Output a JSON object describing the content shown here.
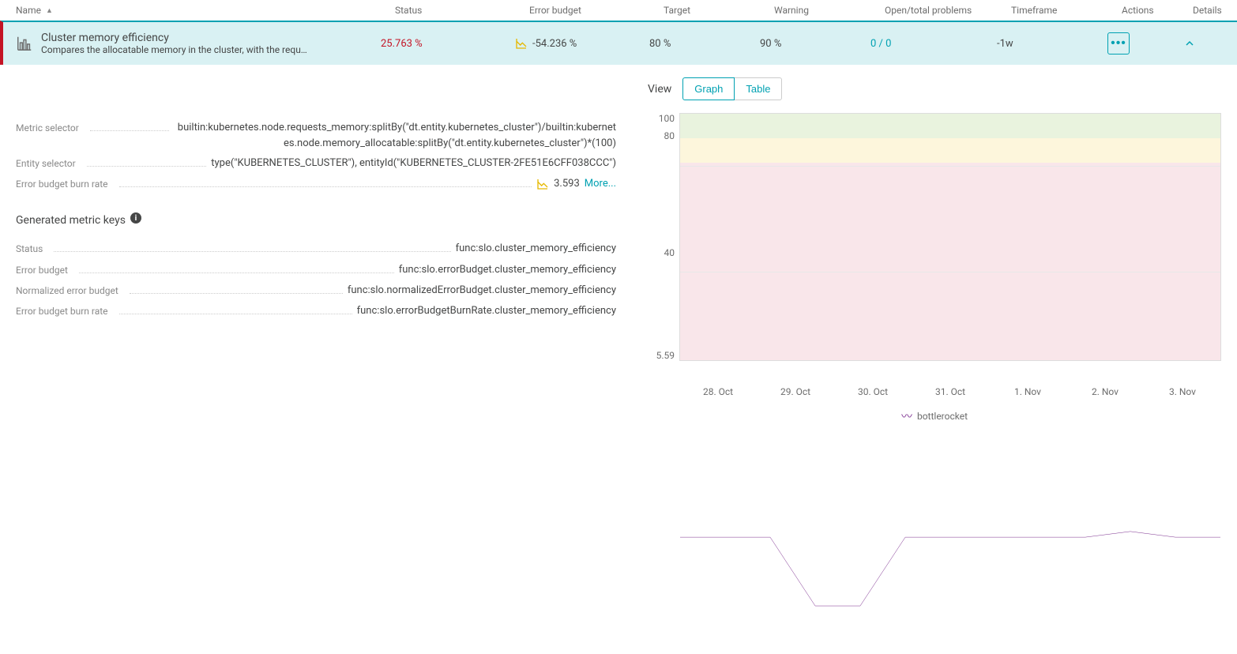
{
  "columns": {
    "name": "Name",
    "status": "Status",
    "error_budget": "Error budget",
    "target": "Target",
    "warning": "Warning",
    "problems": "Open/total problems",
    "timeframe": "Timeframe",
    "actions": "Actions",
    "details": "Details"
  },
  "row": {
    "title": "Cluster memory efficiency",
    "desc": "Compares the allocatable memory in the cluster, with the requ…",
    "status": "25.763 %",
    "error_budget": "-54.236 %",
    "target": "80 %",
    "warning": "90 %",
    "problems": "0 / 0",
    "timeframe": "-1w"
  },
  "details": {
    "labels": {
      "metric_selector": "Metric selector",
      "entity_selector": "Entity selector",
      "burn_rate": "Error budget burn rate",
      "status": "Status",
      "error_budget": "Error budget",
      "normalized": "Normalized error budget",
      "burn_rate2": "Error budget burn rate"
    },
    "metric_selector": "builtin:kubernetes.node.requests_memory:splitBy(\"dt.entity.kubernetes_cluster\")/builtin:kubernetes.node.memory_allocatable:splitBy(\"dt.entity.kubernetes_cluster\")*(100)",
    "entity_selector": "type(\"KUBERNETES_CLUSTER\"), entityId(\"KUBERNETES_CLUSTER-2FE51E6CFF038CCC\")",
    "burn_rate": "3.593",
    "more": "More...",
    "section_title": "Generated metric keys",
    "status_key": "func:slo.cluster_memory_efficiency",
    "error_budget_key": "func:slo.errorBudget.cluster_memory_efficiency",
    "normalized_key": "func:slo.normalizedErrorBudget.cluster_memory_efficiency",
    "burn_rate_key": "func:slo.errorBudgetBurnRate.cluster_memory_efficiency"
  },
  "view": {
    "label": "View",
    "graph": "Graph",
    "table": "Table"
  },
  "chart_data": {
    "type": "line",
    "title": "",
    "xlabel": "",
    "ylabel": "",
    "ylim": [
      5.59,
      100
    ],
    "yticks": [
      100,
      80,
      40,
      5.59
    ],
    "target_band_top": 100,
    "warning_band_top": 90,
    "failure_band_top": 80,
    "x": [
      "28. Oct",
      "29. Oct",
      "30. Oct",
      "31. Oct",
      "1. Nov",
      "2. Nov",
      "3. Nov"
    ],
    "series": [
      {
        "name": "bottlerocket",
        "color": "#7b2d8e",
        "values": [
          26,
          26,
          26,
          14,
          14,
          26,
          26,
          26,
          26,
          26,
          27,
          26,
          26
        ]
      }
    ]
  },
  "icons": {
    "sort_asc": "sort-asc-icon",
    "bars": "bar-chart-icon",
    "burn": "chart-burn-icon",
    "info": "info-icon",
    "more": "more-actions-icon",
    "chevron_up": "chevron-up-icon",
    "legend_line": "series-line-icon"
  }
}
